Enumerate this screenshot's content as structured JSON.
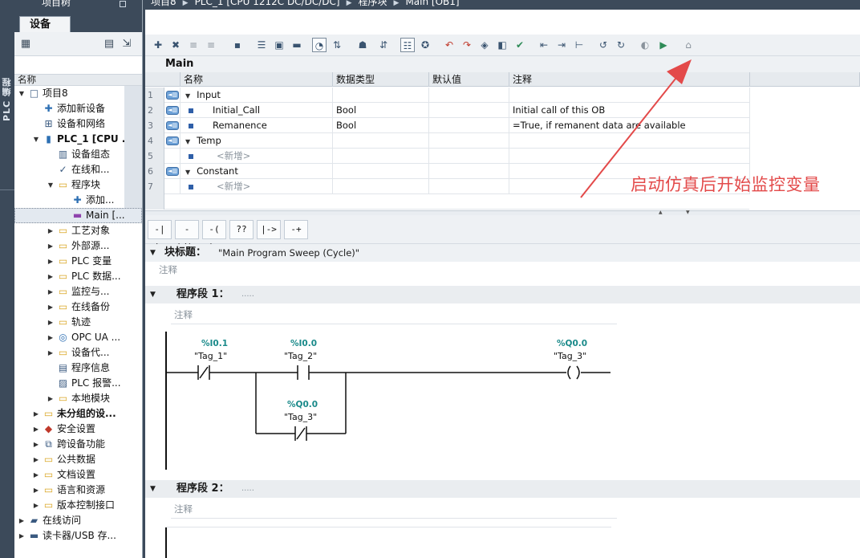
{
  "strip_label": "PLC 编程",
  "topbar": {
    "items": [
      "项目8",
      "PLC_1 [CPU 1212C DC/DC/DC]",
      "程序块",
      "Main [OB1]"
    ]
  },
  "tree_panel": {
    "title": "项目树",
    "tab": "设备",
    "header": "名称",
    "items": [
      {
        "label": "项目8",
        "icon": "project-icon"
      },
      {
        "label": "添加新设备",
        "icon": "add-device-icon"
      },
      {
        "label": "设备和网络",
        "icon": "network-icon"
      },
      {
        "label": "PLC_1 [CPU ...",
        "icon": "plc-icon"
      },
      {
        "label": "设备组态",
        "icon": "device-config-icon"
      },
      {
        "label": "在线和...",
        "icon": "online-diagnostics-icon"
      },
      {
        "label": "程序块",
        "icon": "folder-icon"
      },
      {
        "label": "添加...",
        "icon": "add-block-icon"
      },
      {
        "label": "Main [...",
        "icon": "ob-block-icon"
      },
      {
        "label": "工艺对象",
        "icon": "folder-icon"
      },
      {
        "label": "外部源...",
        "icon": "folder-icon"
      },
      {
        "label": "PLC 变量",
        "icon": "folder-icon"
      },
      {
        "label": "PLC 数据...",
        "icon": "folder-icon"
      },
      {
        "label": "监控与...",
        "icon": "folder-icon"
      },
      {
        "label": "在线备份",
        "icon": "folder-icon"
      },
      {
        "label": "轨迹",
        "icon": "folder-icon"
      },
      {
        "label": "OPC UA ...",
        "icon": "opc-icon"
      },
      {
        "label": "设备代...",
        "icon": "folder-icon"
      },
      {
        "label": "程序信息",
        "icon": "program-info-icon"
      },
      {
        "label": "PLC 报警...",
        "icon": "alarm-icon"
      },
      {
        "label": "本地模块",
        "icon": "folder-icon"
      },
      {
        "label": "未分组的设...",
        "icon": "folder-icon"
      },
      {
        "label": "安全设置",
        "icon": "security-icon"
      },
      {
        "label": "跨设备功能",
        "icon": "cross-device-icon"
      },
      {
        "label": "公共数据",
        "icon": "folder-icon"
      },
      {
        "label": "文档设置",
        "icon": "folder-icon"
      },
      {
        "label": "语言和资源",
        "icon": "folder-icon"
      },
      {
        "label": "版本控制接口",
        "icon": "folder-icon"
      },
      {
        "label": "在线访问",
        "icon": "online-access-icon"
      },
      {
        "label": "读卡器/USB 存...",
        "icon": "card-reader-icon"
      }
    ]
  },
  "interface": {
    "title": "Main",
    "columns": [
      "名称",
      "数据类型",
      "默认值",
      "注释"
    ],
    "rows": [
      {
        "num": "1",
        "name": "Input",
        "type": "",
        "default": "",
        "comment": "",
        "kind": "section"
      },
      {
        "num": "2",
        "name": "Initial_Call",
        "type": "Bool",
        "default": "",
        "comment": "Initial call of this OB",
        "kind": "var"
      },
      {
        "num": "3",
        "name": "Remanence",
        "type": "Bool",
        "default": "",
        "comment": "=True, if remanent data are available",
        "kind": "var"
      },
      {
        "num": "4",
        "name": "Temp",
        "type": "",
        "default": "",
        "comment": "",
        "kind": "section"
      },
      {
        "num": "5",
        "name": "<新增>",
        "type": "",
        "default": "",
        "comment": "",
        "kind": "new"
      },
      {
        "num": "6",
        "name": "Constant",
        "type": "",
        "default": "",
        "comment": "",
        "kind": "section"
      },
      {
        "num": "7",
        "name": "<新增>",
        "type": "",
        "default": "",
        "comment": "",
        "kind": "new"
      }
    ]
  },
  "lad_toolbar": {
    "buttons": [
      "-| |-",
      "-|/|-",
      "-( )-",
      "??",
      "|->",
      "-+"
    ]
  },
  "block": {
    "title_label": "块标题：",
    "title_value": "\"Main Program Sweep (Cycle)\"",
    "comment": "注释"
  },
  "networks": [
    {
      "label": "程序段 1：",
      "dots": ".....",
      "comment": "注释"
    },
    {
      "label": "程序段 2：",
      "dots": ".....",
      "comment": "注释"
    }
  ],
  "ladder": {
    "contact1": {
      "addr": "%I0.1",
      "tag": "\"Tag_1\""
    },
    "contact2": {
      "addr": "%I0.0",
      "tag": "\"Tag_2\""
    },
    "coil": {
      "addr": "%Q0.0",
      "tag": "\"Tag_3\""
    },
    "contact3": {
      "addr": "%Q0.0",
      "tag": "\"Tag_3\""
    }
  },
  "annotation": {
    "text": "启动仿真后开始监控变量",
    "color": "#e34a4a"
  },
  "colors": {
    "title_bar": "#3c4a5a",
    "panel_bg": "#eef1f4",
    "address_teal": "#1a8a8a"
  }
}
